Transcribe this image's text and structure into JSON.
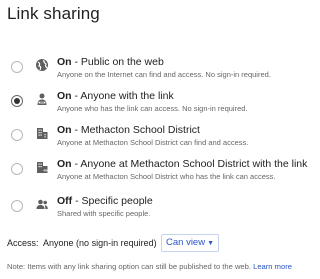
{
  "title": "Link sharing",
  "options": [
    {
      "bold": "On",
      "rest": " - Public on the web",
      "desc": "Anyone on the Internet can find and access. No sign-in required.",
      "icon": "globe-icon",
      "selected": false
    },
    {
      "bold": "On",
      "rest": " - Anyone with the link",
      "desc": "Anyone who has the link can access. No sign-in required.",
      "icon": "link-person-icon",
      "selected": true
    },
    {
      "bold": "On",
      "rest": " - Methacton School District",
      "desc": "Anyone at Methacton School District can find and access.",
      "icon": "building-icon",
      "selected": false
    },
    {
      "bold": "On",
      "rest": " - Anyone at Methacton School District with the link",
      "desc": "Anyone at Methacton School District who has the link can access.",
      "icon": "building-link-icon",
      "selected": false
    },
    {
      "bold": "Off",
      "rest": " - Specific people",
      "desc": "Shared with specific people.",
      "icon": "people-icon",
      "selected": false
    }
  ],
  "access": {
    "label": "Access:",
    "value": "Anyone (no sign-in required)",
    "dropdown_label": "Can view"
  },
  "note": {
    "text": "Note: Items with any link sharing option can still be published to the web.",
    "link": "Learn more"
  },
  "colors": {
    "link": "#2a56c6",
    "text": "#222222",
    "muted": "#666666"
  }
}
